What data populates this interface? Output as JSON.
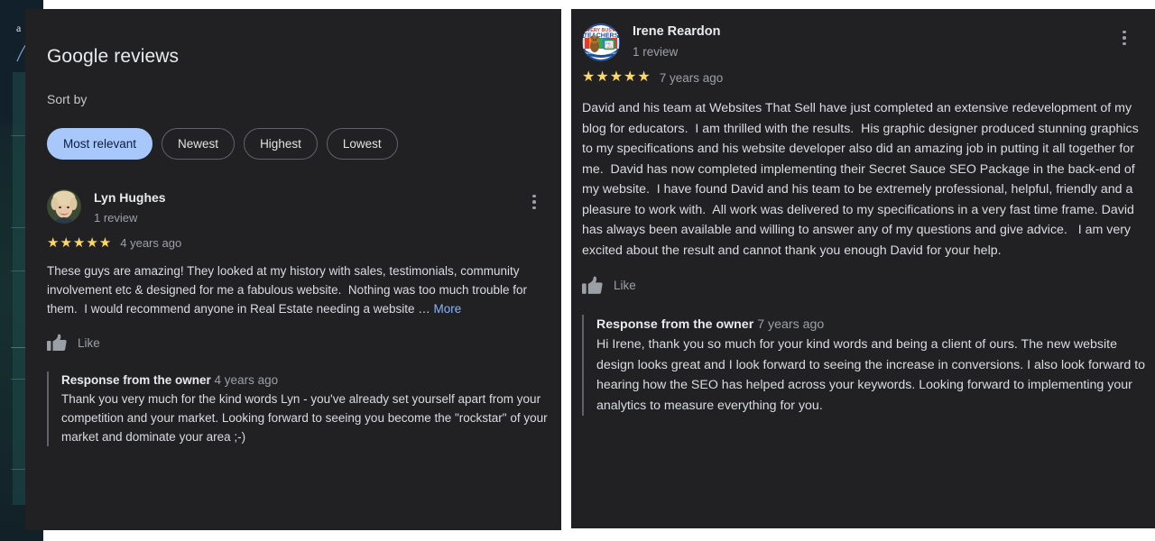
{
  "background_page": {
    "fragment_letter": "a"
  },
  "colors": {
    "panel_background": "#212124",
    "page_background": "#ffffff",
    "chip_active_background": "#a8c7fa",
    "chip_active_text": "#0b1f3b",
    "star": "#fdd663",
    "link": "#8ab4f8",
    "primary_text": "#e8eaed",
    "secondary_text": "#9aa0a6",
    "body_text": "#dadce0"
  },
  "left_panel": {
    "title": "Google reviews",
    "sort_by_label": "Sort by",
    "sort_chips": [
      {
        "label": "Most relevant",
        "active": true
      },
      {
        "label": "Newest",
        "active": false
      },
      {
        "label": "Highest",
        "active": false
      },
      {
        "label": "Lowest",
        "active": false
      }
    ],
    "review": {
      "avatar_icon": "user-photo-avatar",
      "reviewer_name": "Lyn Hughes",
      "review_count": "1 review",
      "stars": "★★★★★",
      "rating_value": 5,
      "time_ago": "4 years ago",
      "body": "These guys are amazing! They looked at my history with sales, testimonials, community involvement etc & designed for me a fabulous website.  Nothing was too much trouble for them.  I would recommend anyone in Real Estate needing a website … ",
      "more_label": "More",
      "like_label": "Like",
      "like_icon": "thumbs-up-icon",
      "menu_icon": "kebab-menu-icon",
      "owner_response": {
        "heading": "Response from the owner",
        "time_ago": "4 years ago",
        "text": "Thank you very much for the kind words Lyn - you've already set yourself apart from your competition and your market. Looking forward to seeing you become the \"rockstar\" of your market and dominate your area ;-)"
      }
    }
  },
  "right_panel": {
    "review": {
      "avatar_icon": "very-busy-teachers-logo-avatar",
      "reviewer_name": "Irene Reardon",
      "review_count": "1 review",
      "stars": "★★★★★",
      "rating_value": 5,
      "time_ago": "7 years ago",
      "body": "David and his team at Websites That Sell have just completed an extensive redevelopment of my blog for educators.  I am thrilled with the results.  His graphic designer produced stunning graphics to my specifications and his website developer also did an amazing job in putting it all together for me.  David has now completed implementing their Secret Sauce SEO Package in the back-end of my website.  I have found David and his team to be extremely professional, helpful, friendly and a pleasure to work with.  All work was delivered to my specifications in a very fast time frame. David has always been available and willing to answer any of my questions and give advice.   I am very excited about the result and cannot thank you enough David for your help.",
      "like_label": "Like",
      "like_icon": "thumbs-up-icon",
      "menu_icon": "kebab-menu-icon",
      "owner_response": {
        "heading": "Response from the owner",
        "time_ago": "7 years ago",
        "text": "Hi Irene, thank you so much for your kind words and being a client of ours. The new website design looks great and I look forward to seeing the increase in conversions. I also look forward to hearing how the SEO has helped across your keywords. Looking forward to implementing your analytics to measure everything for you."
      }
    }
  }
}
